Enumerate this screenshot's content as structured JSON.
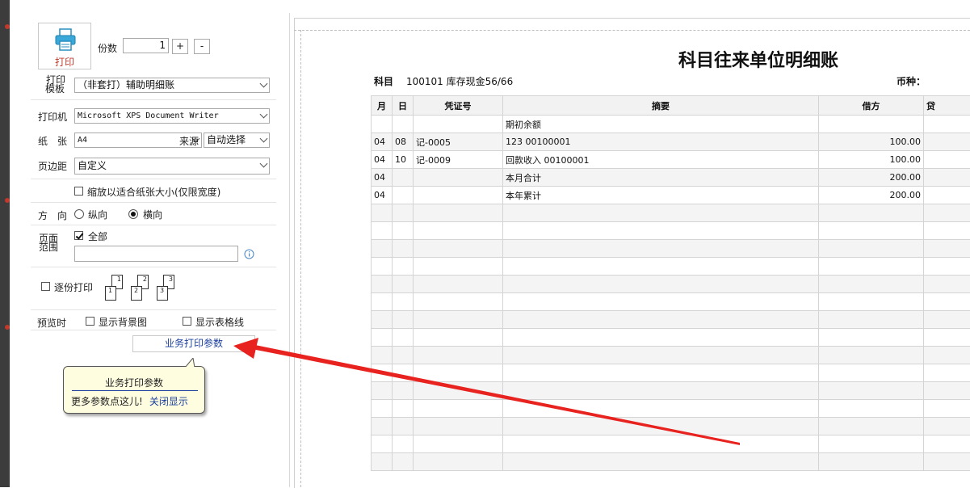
{
  "print": {
    "button_label": "打印",
    "copies_label": "份数",
    "copies_value": "1",
    "plus_label": "+",
    "minus_label": "-",
    "template_label_1": "打印",
    "template_label_2": "模板",
    "template_value": "（非套打）辅助明细账",
    "printer_label": "打印机",
    "printer_value": "Microsoft XPS Document Writer",
    "paper_label": "纸　张",
    "paper_value": "A4",
    "source_label": "来源",
    "source_value": "自动选择",
    "margin_label": "页边距",
    "margin_value": "自定义",
    "fit_label": "缩放以适合纸张大小(仅限宽度)",
    "orientation_label": "方　向",
    "portrait_label": "纵向",
    "landscape_label": "横向",
    "range_label_1": "页面",
    "range_label_2": "范围",
    "all_label": "全部",
    "collate_label": "逐份打印",
    "preview_label": "预览时",
    "show_bg_label": "显示背景图",
    "show_grid_label": "显示表格线",
    "biz_button_label": "业务打印参数"
  },
  "tooltip": {
    "title": "业务打印参数",
    "text": "更多参数点这儿!",
    "close_link": "关闭显示"
  },
  "report": {
    "title": "科目往来单位明细账",
    "subject_label": "科目",
    "subject_value": "100101 库存现金56/66",
    "currency_label": "币种：",
    "headers": [
      "月",
      "日",
      "凭证号",
      "摘要",
      "借方",
      "贷"
    ],
    "rows": [
      [
        "",
        "",
        "",
        "期初余额",
        "",
        ""
      ],
      [
        "04",
        "08",
        "记-0005",
        "123 00100001",
        "100.00",
        ""
      ],
      [
        "04",
        "10",
        "记-0009",
        "回款收入 00100001",
        "100.00",
        ""
      ],
      [
        "04",
        "",
        "",
        "本月合计",
        "200.00",
        ""
      ],
      [
        "04",
        "",
        "",
        "本年累计",
        "200.00",
        ""
      ]
    ]
  },
  "colors": {
    "accent_red": "#c0392b",
    "link_blue": "#1a3f9c",
    "tooltip_bg": "#fffde0"
  }
}
